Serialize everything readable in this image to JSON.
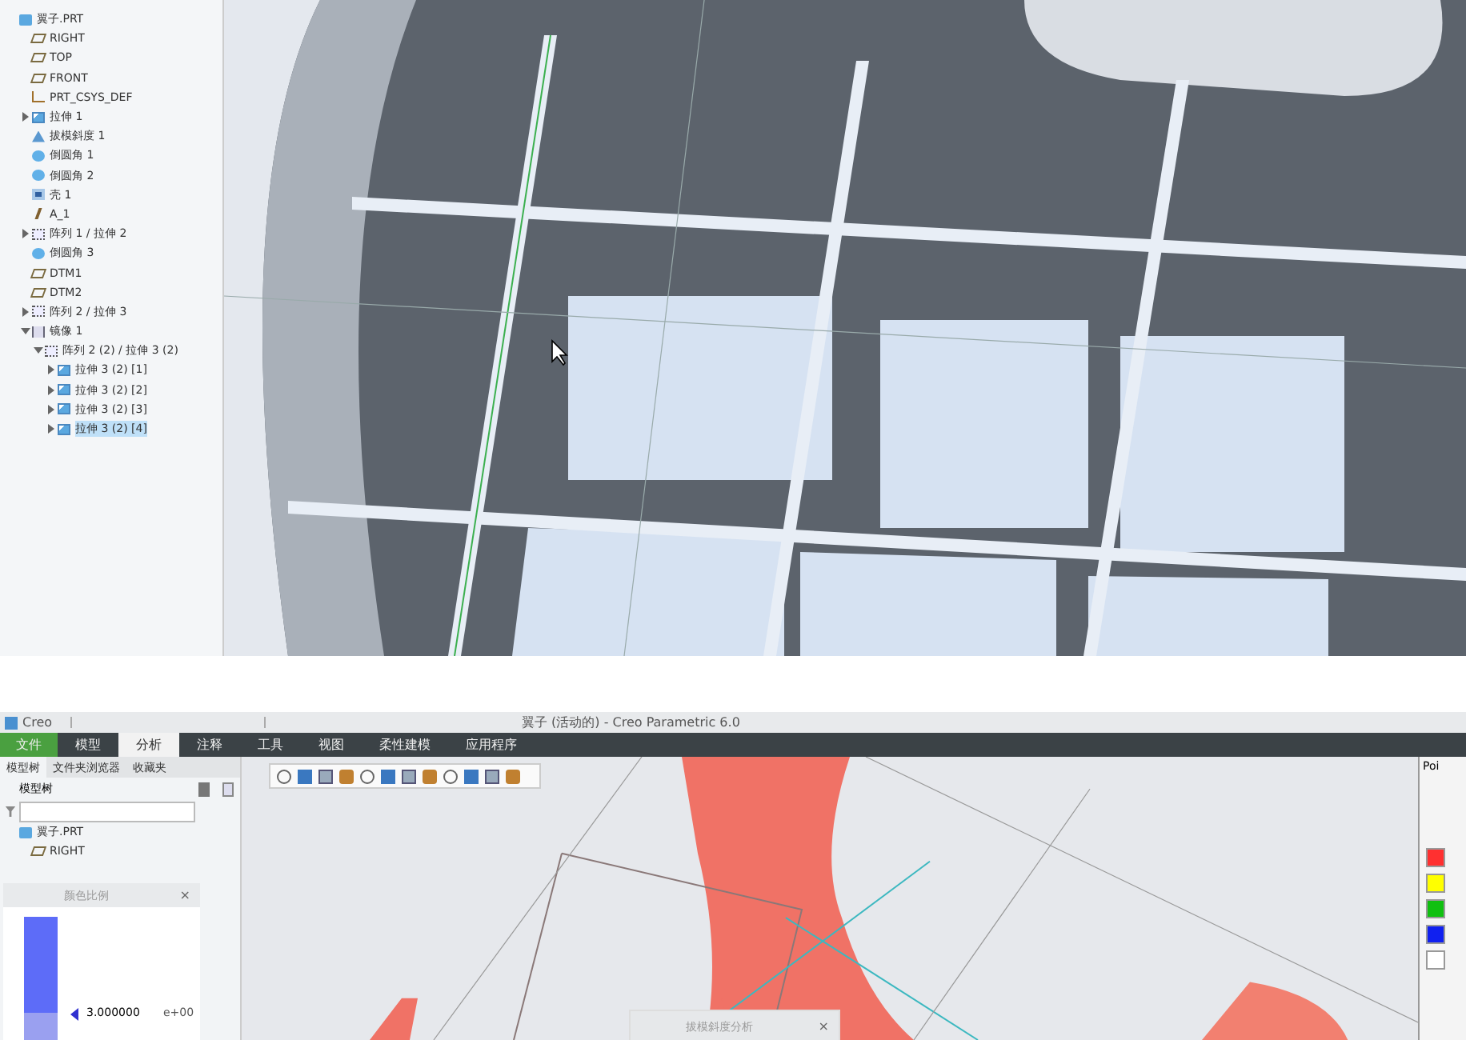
{
  "top_panel": {
    "tree": [
      {
        "label": "翼子.PRT",
        "kind": "part",
        "selected": false,
        "children": [
          {
            "label": "RIGHT",
            "kind": "plane",
            "selected": false
          },
          {
            "label": "TOP",
            "kind": "plane",
            "selected": false
          },
          {
            "label": "FRONT",
            "kind": "plane",
            "selected": false
          },
          {
            "label": "PRT_CSYS_DEF",
            "kind": "csys",
            "selected": false
          },
          {
            "label": "拉伸 1",
            "kind": "extrude",
            "selected": false,
            "expanded": false
          },
          {
            "label": "拔模斜度 1",
            "kind": "draft",
            "selected": false
          },
          {
            "label": "倒圆角 1",
            "kind": "round",
            "selected": false
          },
          {
            "label": "倒圆角 2",
            "kind": "round",
            "selected": false
          },
          {
            "label": "壳 1",
            "kind": "shell",
            "selected": false
          },
          {
            "label": "A_1",
            "kind": "axis",
            "selected": false
          },
          {
            "label": "阵列 1 / 拉伸 2",
            "kind": "pattern",
            "selected": false,
            "expanded": false
          },
          {
            "label": "倒圆角 3",
            "kind": "round",
            "selected": false
          },
          {
            "label": "DTM1",
            "kind": "plane",
            "selected": false
          },
          {
            "label": "DTM2",
            "kind": "plane",
            "selected": false
          },
          {
            "label": "阵列 2 / 拉伸 3",
            "kind": "pattern",
            "selected": false,
            "expanded": false
          },
          {
            "label": "镜像 1",
            "kind": "mirror",
            "selected": false,
            "expanded": true,
            "children": [
              {
                "label": "阵列 2 (2) / 拉伸 3 (2)",
                "kind": "pattern",
                "selected": false,
                "expanded": true,
                "children": [
                  {
                    "label": "拉伸 3 (2) [1]",
                    "kind": "extrude",
                    "selected": false,
                    "expanded": false
                  },
                  {
                    "label": "拉伸 3 (2) [2]",
                    "kind": "extrude",
                    "selected": false,
                    "expanded": false
                  },
                  {
                    "label": "拉伸 3 (2) [3]",
                    "kind": "extrude",
                    "selected": false,
                    "expanded": false
                  },
                  {
                    "label": "拉伸 3 (2) [4]",
                    "kind": "extrude",
                    "selected": true,
                    "expanded": false
                  }
                ]
              }
            ]
          }
        ]
      }
    ]
  },
  "bottom_panel": {
    "app_name": "Creo",
    "window_title": "翼子 (活动的) - Creo Parametric 6.0",
    "ribbon_tabs": [
      {
        "label": "文件",
        "kind": "file",
        "selected": false
      },
      {
        "label": "模型",
        "kind": "tab",
        "selected": false
      },
      {
        "label": "分析",
        "kind": "tab",
        "selected": true
      },
      {
        "label": "注释",
        "kind": "tab",
        "selected": false
      },
      {
        "label": "工具",
        "kind": "tab",
        "selected": false
      },
      {
        "label": "视图",
        "kind": "tab",
        "selected": false
      },
      {
        "label": "柔性建模",
        "kind": "tab",
        "selected": false
      },
      {
        "label": "应用程序",
        "kind": "tab",
        "selected": false
      }
    ],
    "navigator_tabs": [
      {
        "label": "模型树",
        "selected": true
      },
      {
        "label": "文件夹浏览器",
        "selected": false
      },
      {
        "label": "收藏夹",
        "selected": false
      }
    ],
    "tree_title": "模型树",
    "tree": [
      {
        "label": "翼子.PRT",
        "kind": "part",
        "selected": false,
        "children": [
          {
            "label": "RIGHT",
            "kind": "plane",
            "selected": false
          }
        ]
      }
    ],
    "color_scale_dialog": {
      "title": "颜色比例",
      "close": "×",
      "value": "3.000000",
      "exponent": "e+00"
    },
    "draft_dialog": {
      "title": "拔模斜度分析",
      "close": "×"
    },
    "palette_label": "Poi",
    "palette_colors": [
      {
        "color": "#ff3030"
      },
      {
        "color": "#ffff00"
      },
      {
        "color": "#10c010"
      },
      {
        "color": "#1020f0"
      },
      {
        "color": "#ffffff"
      }
    ]
  }
}
